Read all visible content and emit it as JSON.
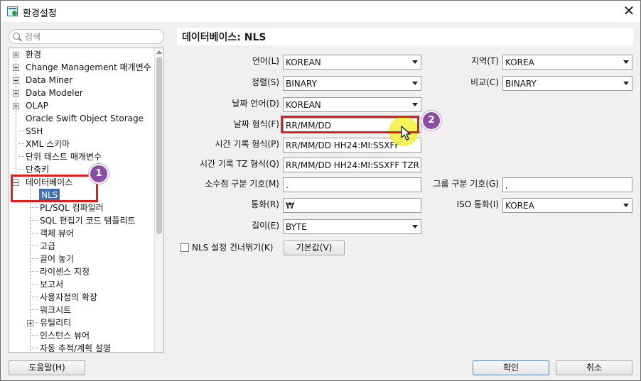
{
  "window": {
    "title": "환경설정",
    "close_label": "✕"
  },
  "search": {
    "placeholder": "검색"
  },
  "tree": {
    "items": [
      {
        "label": "환경",
        "expandable": true
      },
      {
        "label": "Change Management 매개변수",
        "expandable": true
      },
      {
        "label": "Data Miner",
        "expandable": true
      },
      {
        "label": "Data Modeler",
        "expandable": true
      },
      {
        "label": "OLAP",
        "expandable": true
      },
      {
        "label": "Oracle Swift Object Storage",
        "expandable": false
      },
      {
        "label": "SSH",
        "expandable": false
      },
      {
        "label": "XML 스키마",
        "expandable": false
      },
      {
        "label": "단위 테스트 매개변수",
        "expandable": false
      },
      {
        "label": "단축키",
        "expandable": false
      },
      {
        "label": "데이터베이스",
        "expandable": true,
        "expanded": true
      },
      {
        "label": "NLS",
        "selected": true
      },
      {
        "label": "PL/SQL 컴파일러"
      },
      {
        "label": "SQL 편집기 코드 템플리트"
      },
      {
        "label": "객체 뷰어"
      },
      {
        "label": "고급"
      },
      {
        "label": "끌어 놓기"
      },
      {
        "label": "라이센스 지정"
      },
      {
        "label": "보고서"
      },
      {
        "label": "사용자정의 확장"
      },
      {
        "label": "워크시트"
      },
      {
        "label": "유틸리티",
        "expandable": true
      },
      {
        "label": "인스턴스 뷰어"
      },
      {
        "label": "자동 추적/계획 설명"
      }
    ]
  },
  "panel": {
    "title": "데이터베이스: NLS",
    "language": {
      "label": "언어(L)",
      "value": "KOREAN"
    },
    "territory": {
      "label": "지역(T)",
      "value": "KOREA"
    },
    "sort": {
      "label": "정렬(S)",
      "value": "BINARY"
    },
    "comparison": {
      "label": "비교(C)",
      "value": "BINARY"
    },
    "date_language": {
      "label": "날짜 언어(D)",
      "value": "KOREAN"
    },
    "date_format": {
      "label": "날짜 형식(F)",
      "value": "RR/MM/DD"
    },
    "timestamp_format": {
      "label": "시간 기록 형식(P)",
      "value": "RR/MM/DD HH24:MI:SSXFF"
    },
    "timestamp_tz_format": {
      "label": "시간 기록 TZ 형식(Q)",
      "value": "RR/MM/DD HH24:MI:SSXFF TZR"
    },
    "decimal_separator": {
      "label": "소수점 구분 기호(M)",
      "value": "."
    },
    "group_separator": {
      "label": "그룹 구분 기호(G)",
      "value": ","
    },
    "currency": {
      "label": "통화(R)",
      "value": "₩"
    },
    "iso_currency": {
      "label": "ISO 통화(I)",
      "value": "KOREA"
    },
    "length": {
      "label": "길이(E)",
      "value": "BYTE"
    },
    "skip_nls": {
      "label": "NLS 설정 건너뛰기(K)",
      "checked": false
    },
    "defaults_button": "기본값(V)"
  },
  "footer": {
    "help_button": "도움말(H)",
    "ok_button": "확인",
    "cancel_button": "취소"
  },
  "annotations": {
    "badge1": "1",
    "badge2": "2",
    "highlight_color": "#e21b1b",
    "badge_color": "#8b4ea3"
  }
}
